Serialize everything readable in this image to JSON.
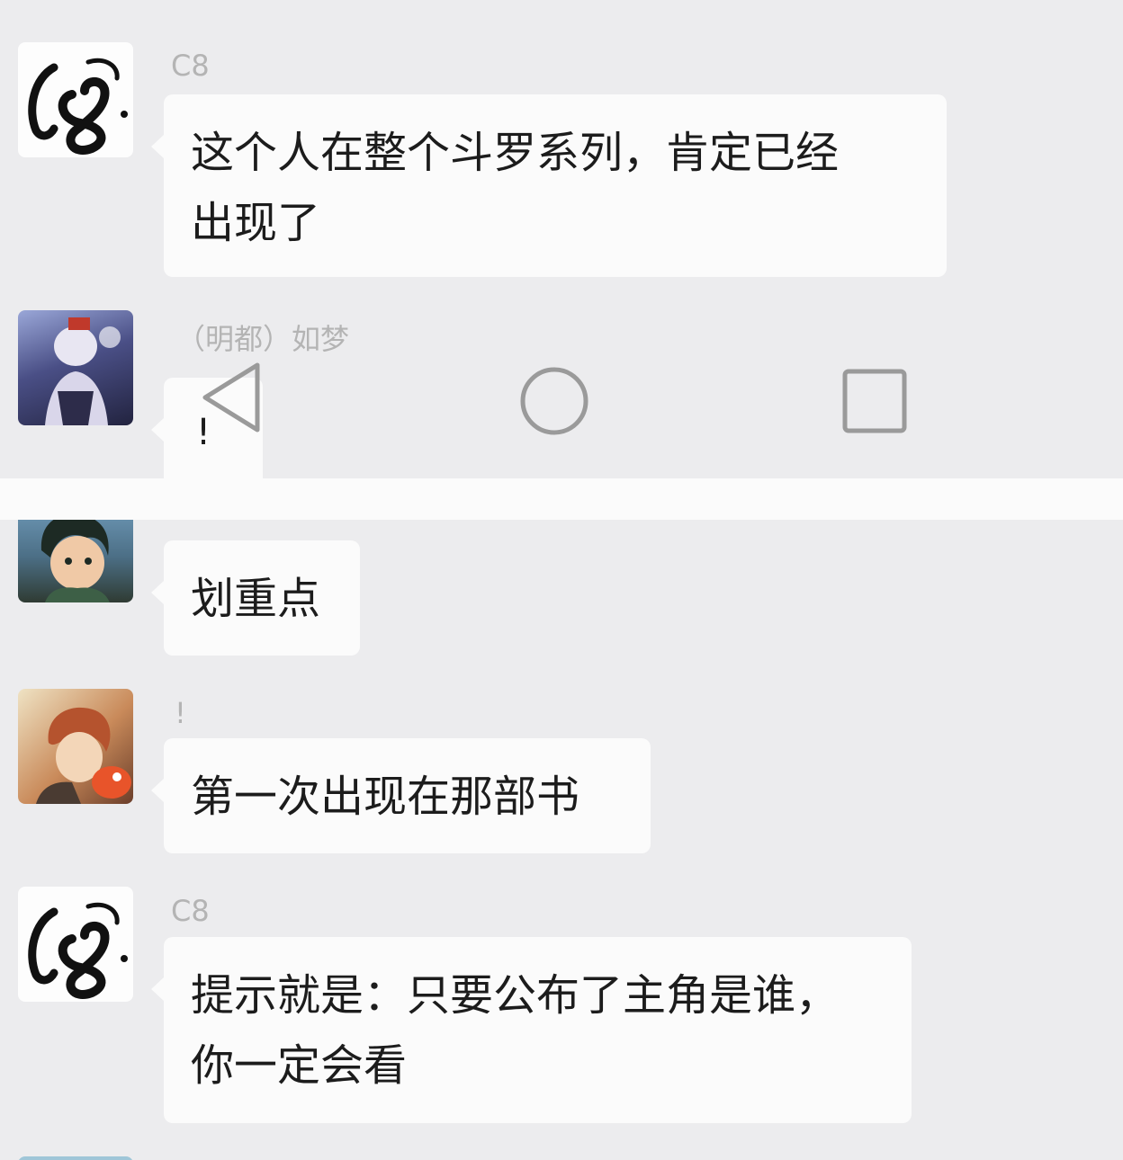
{
  "messages": [
    {
      "sender": "C8",
      "lines": [
        "这个人在整个斗罗系列，肯定已经",
        "出现了"
      ]
    },
    {
      "sender": "（明都）如梦",
      "lines": [
        "!"
      ]
    },
    {
      "sender": "",
      "lines": [
        "划重点"
      ]
    },
    {
      "sender": "!",
      "lines": [
        "第一次出现在那部书"
      ]
    },
    {
      "sender": "C8",
      "lines": [
        "提示就是：只要公布了主角是谁，",
        "你一定会看"
      ]
    }
  ],
  "nav": {
    "icons": [
      "back-icon",
      "home-icon",
      "recents-icon"
    ]
  },
  "colors": {
    "background": "#ececee",
    "bubble": "#fbfbfb",
    "name": "#b4b4b4",
    "text": "#1c1c1c"
  }
}
